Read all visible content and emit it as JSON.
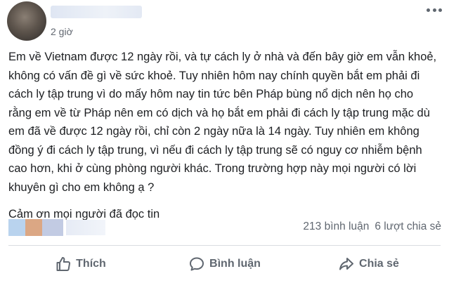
{
  "post": {
    "time": "2 giờ",
    "body": "Em về Vietnam được 12 ngày rồi, và tự cách ly ở nhà và đến bây giờ em vẫn khoẻ, không có vấn đề gì về sức khoẻ. Tuy nhiên hôm nay chính quyền bắt em phải đi cách ly tập trung vì do mấy hôm nay tin tức bên Pháp bùng nổ dịch nên họ cho rằng em về từ Pháp nên em có dịch và họ bắt em phải đi cách ly tập trung mặc dù em đã về được 12 ngày rồi, chỉ còn 2 ngày nữa là 14 ngày. Tuy nhiên em không đồng ý đi cách ly tập trung, vì nếu đi cách ly tập trung sẽ có nguy cơ nhiễm bệnh cao hơn, khi ở cùng phòng người khác. Trong trường hợp này mọi người có lời khuyên gì cho em không ạ ?",
    "thanks": "Cảm ơn mọi người đã đọc tin"
  },
  "stats": {
    "comments": "213 bình luận",
    "shares": "6 lượt chia sẻ"
  },
  "actions": {
    "like": "Thích",
    "comment": "Bình luận",
    "share": "Chia sẻ"
  },
  "icons": {
    "menu": "more-horizontal-icon",
    "like": "thumbs-up-icon",
    "comment": "comment-bubble-icon",
    "share": "share-arrow-icon"
  }
}
